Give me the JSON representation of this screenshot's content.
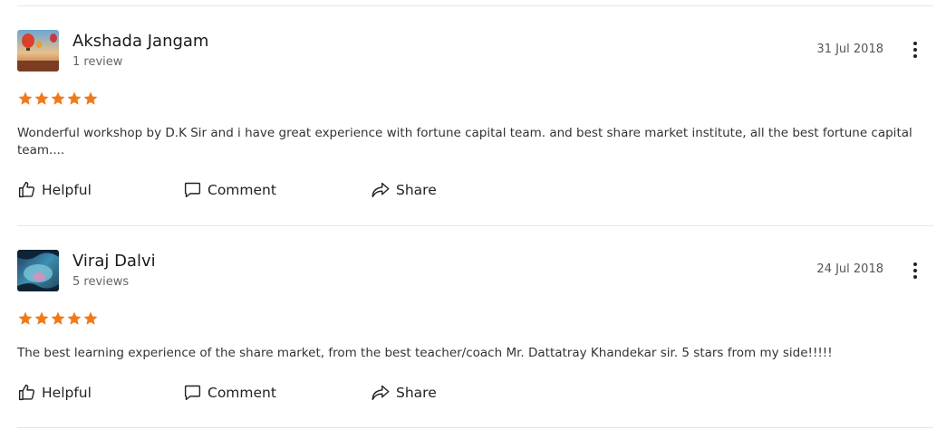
{
  "reviews": [
    {
      "name": "Akshada Jangam",
      "review_count": "1 review",
      "date": "31 Jul 2018",
      "rating": 5,
      "text": "Wonderful workshop by D.K Sir and i have great experience with fortune capital team. and best share market institute, all the best fortune capital team....",
      "actions": {
        "helpful": "Helpful",
        "comment": "Comment",
        "share": "Share"
      }
    },
    {
      "name": "Viraj Dalvi",
      "review_count": "5 reviews",
      "date": "24 Jul 2018",
      "rating": 5,
      "text": "The best learning experience of the share market, from the best teacher/coach Mr. Dattatray Khandekar sir. 5 stars from my side!!!!!",
      "actions": {
        "helpful": "Helpful",
        "comment": "Comment",
        "share": "Share"
      }
    }
  ],
  "colors": {
    "star": "#f07a1a",
    "divider": "#e6e6e6"
  },
  "icons": {
    "helpful": "thumbs-up-icon",
    "comment": "speech-bubble-icon",
    "share": "share-arrow-icon",
    "more": "vertical-dots-icon"
  }
}
